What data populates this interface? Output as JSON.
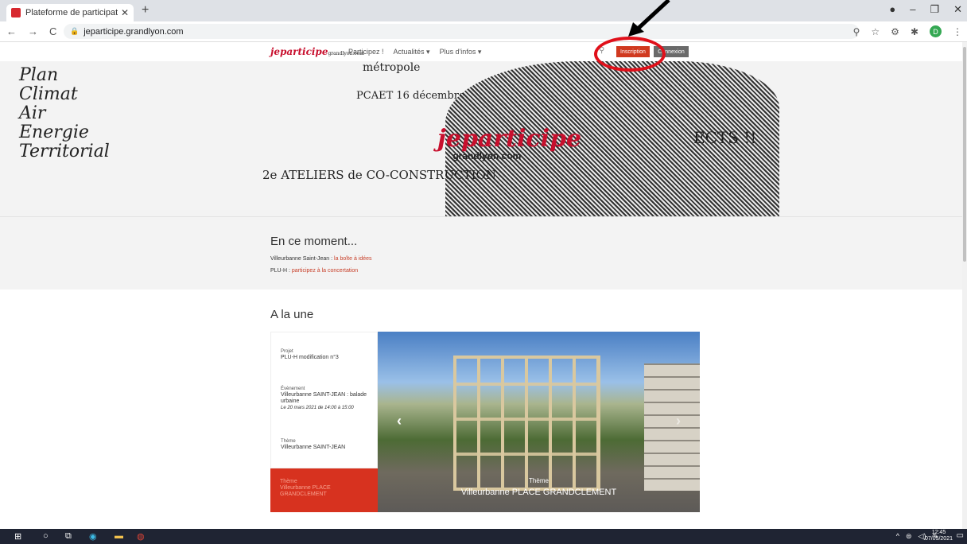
{
  "browser": {
    "tab_title": "Plateforme de participation citoy",
    "tab_close": "✕",
    "new_tab": "+",
    "url": "jeparticipe.grandlyon.com",
    "avatar_letter": "D"
  },
  "site": {
    "logo_main": "jeparticipe",
    "logo_sub": "grandlyon.com",
    "nav": [
      "Participez !",
      "Actualités ▾",
      "Plus d'infos ▾"
    ],
    "inscription": "Inscription",
    "connexion": "Connexion"
  },
  "hero": {
    "words": "Plan\nClimat\nAir\nEnergie\nTerritorial",
    "metropole": "métropole",
    "pcaet": "PCAET 16 décembre",
    "brand": "jeparticipe",
    "brand_sub": ".grandlyon.com",
    "ateliers": "2e ATELIERS de CO-CONSTRUCTION",
    "right_text": "ECTS !!"
  },
  "moment": {
    "title": "En ce moment...",
    "line1_label": "Villeurbanne Saint-Jean",
    "line1_sep": " : ",
    "line1_link": "la boîte à idées",
    "line2_label": "PLU-H",
    "line2_sep": " : ",
    "line2_link": "participez à la concertation"
  },
  "une": {
    "title": "A la une",
    "projet_label": "Projet",
    "projet_value": "PLU-H modification n°3",
    "event_label": "Évènement",
    "event_value": "Villeurbanne SAINT-JEAN : balade urbaine",
    "event_date": "Le 20 mars 2021 de 14:00 à 15:00",
    "theme_label": "Thème",
    "theme_value": "Villeurbanne SAINT-JEAN",
    "active_label": "Thème",
    "active_value": "Villeurbanne PLACE GRANDCLEMENT",
    "caption_label": "Thème",
    "caption_value": "Villeurbanne PLACE GRANDCLEMENT"
  },
  "taskbar": {
    "time": "12:45",
    "date": "07/05/2021"
  },
  "colors": {
    "accent": "#d0391f",
    "annotation": "#e0101a"
  }
}
